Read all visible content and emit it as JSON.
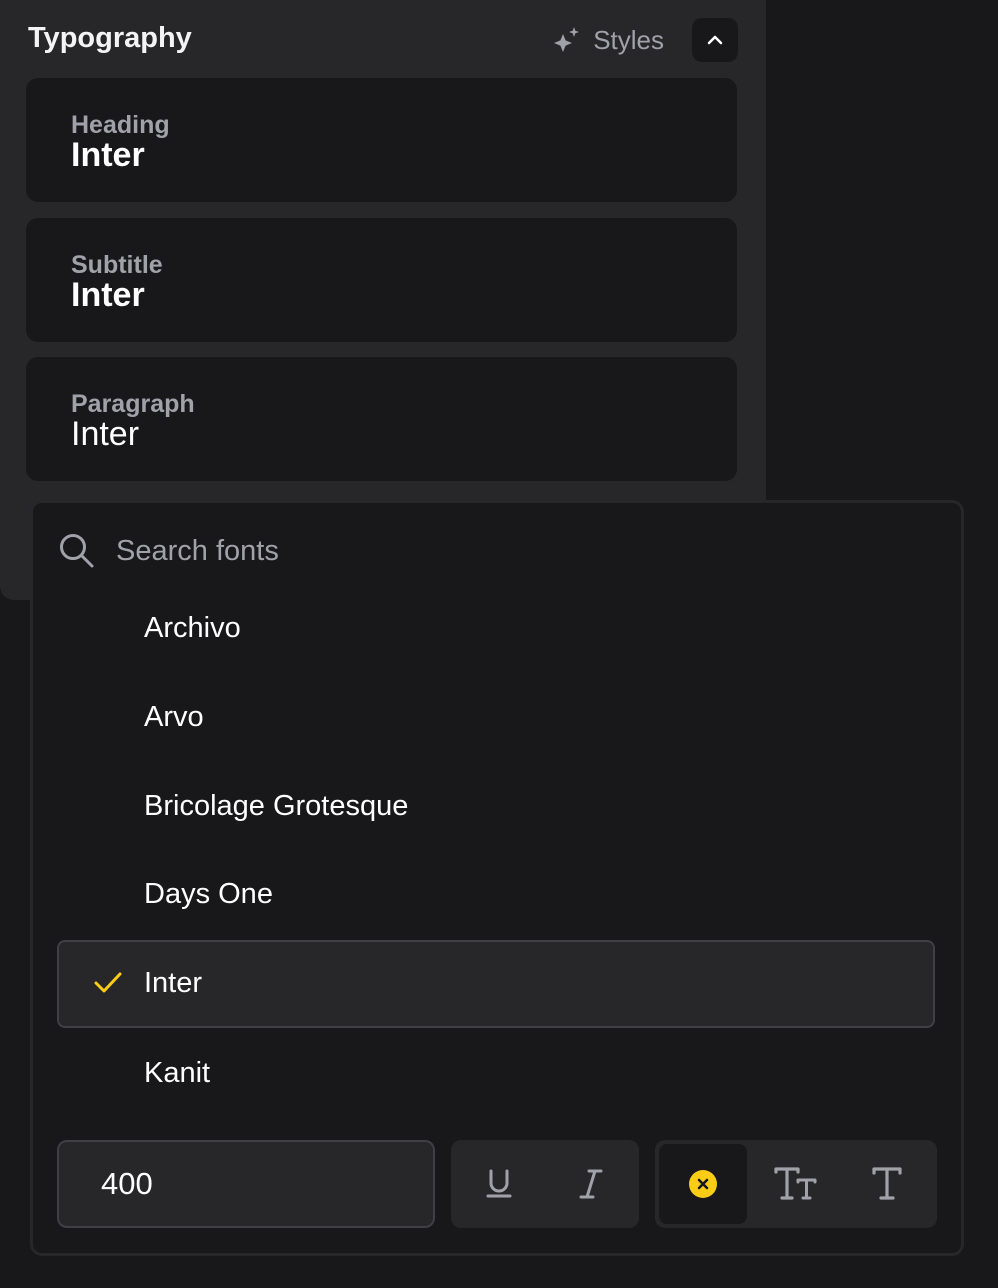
{
  "panel": {
    "title": "Typography",
    "styles_label": "Styles",
    "cards": [
      {
        "label": "Heading",
        "value": "Inter"
      },
      {
        "label": "Subtitle",
        "value": "Inter"
      },
      {
        "label": "Paragraph",
        "value": "Inter"
      }
    ]
  },
  "dropdown": {
    "search_placeholder": "Search fonts",
    "fonts": [
      "Archivo",
      "Arvo",
      "Bricolage Grotesque",
      "Days One",
      "Inter",
      "Kanit"
    ],
    "selected_font": "Inter",
    "weight_value": "400"
  },
  "icons": {
    "styles": "sparkles-icon",
    "collapse": "chevron-up-icon",
    "search": "search-icon",
    "check": "check-icon",
    "underline": "underline-icon",
    "italic": "italic-icon",
    "clear": "clear-x-icon",
    "text_size": "text-size-icon",
    "text": "text-icon"
  },
  "colors": {
    "accent": "#facc15",
    "panel_bg": "#27272a",
    "card_bg": "#18181b",
    "muted_text": "#a1a1aa"
  }
}
